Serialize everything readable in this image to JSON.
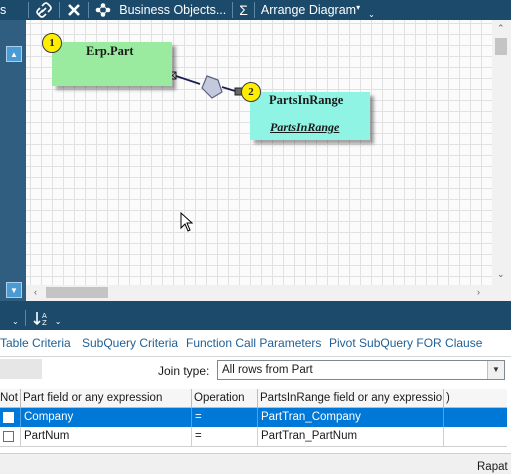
{
  "toolbar": {
    "clip_text": "s",
    "business_objects_label": "Business Objects...",
    "sum_label": "Σ",
    "arrange_label": "Arrange Diagram"
  },
  "diagram": {
    "node1": {
      "badge": "1",
      "title": "Erp.Part"
    },
    "node2": {
      "badge": "2",
      "title": "PartsInRange",
      "subtitle": "PartsInRange"
    }
  },
  "tabs": [
    {
      "label": "Table Criteria"
    },
    {
      "label": "SubQuery Criteria"
    },
    {
      "label": "Function Call Parameters"
    },
    {
      "label": "Pivot SubQuery FOR Clause"
    }
  ],
  "join": {
    "label": "Join type:",
    "value": "All rows from Part"
  },
  "grid": {
    "columns": [
      "Not",
      "Part field or any expression",
      "Operation",
      "PartsInRange field or any expressio",
      ")"
    ],
    "rows": [
      {
        "field": "Company",
        "operation": "=",
        "target": "PartTran_Company",
        "checked": false,
        "selected": true
      },
      {
        "field": "PartNum",
        "operation": "=",
        "target": "PartTran_PartNum",
        "checked": false,
        "selected": false
      }
    ]
  },
  "status": {
    "text": "Rapat"
  },
  "colors": {
    "toolbar_bg": "#1b4a6a",
    "node1_fill": "#9aeaa0",
    "node2_fill": "#8ff4e4",
    "badge_fill": "#ffee00",
    "selection": "#0078d7",
    "tab_text": "#1f5f95"
  }
}
